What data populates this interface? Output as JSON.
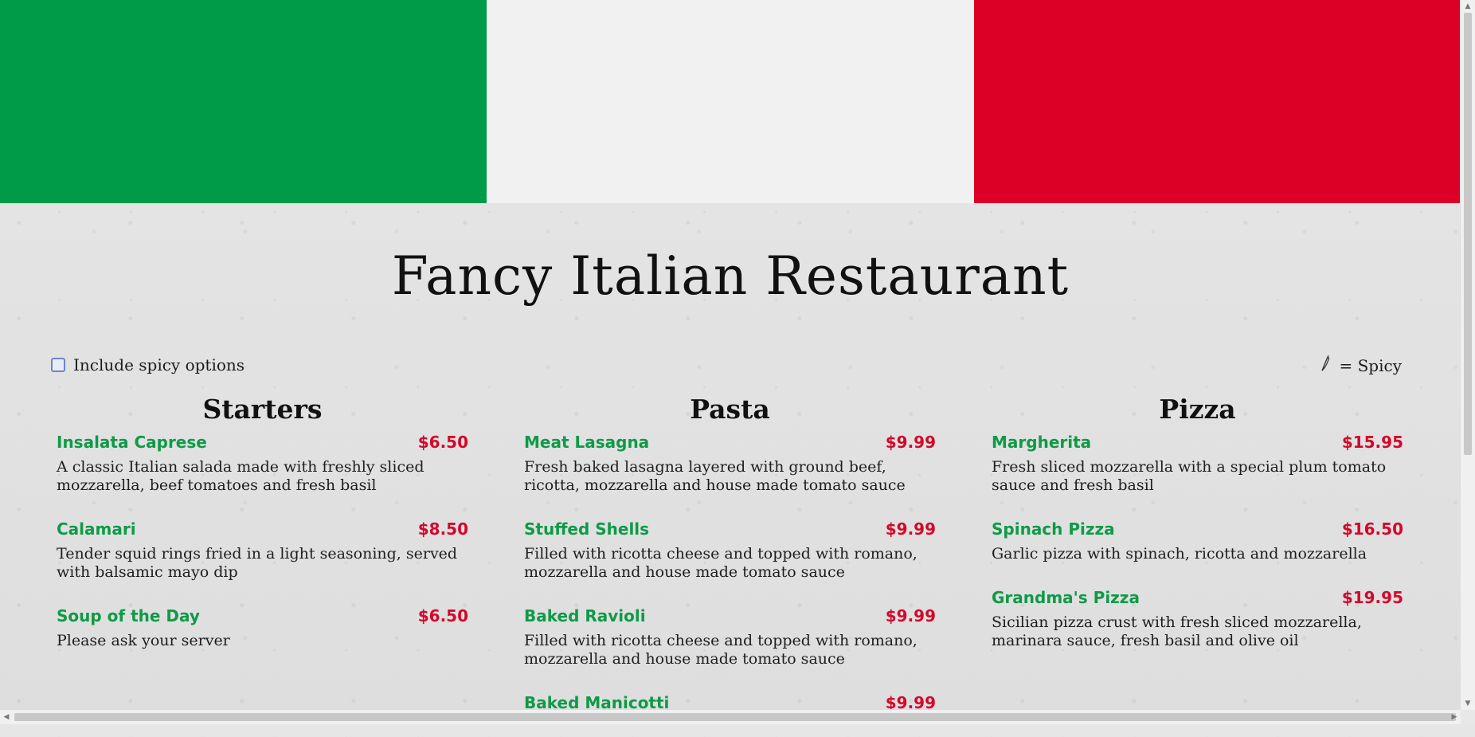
{
  "colors": {
    "green": "#009b48",
    "white": "#f1f1f1",
    "red": "#dc0026"
  },
  "page": {
    "title": "Fancy Italian Restaurant"
  },
  "spicy_toggle": {
    "label": "Include spicy options",
    "checked": false
  },
  "legend": {
    "icon": "chili-pepper-icon",
    "text": "= Spicy"
  },
  "menu": [
    {
      "heading": "Starters",
      "items": [
        {
          "name": "Insalata Caprese",
          "price": "$6.50",
          "desc": "A classic Italian salada made with freshly sliced mozzarella, beef tomatoes and fresh basil"
        },
        {
          "name": "Calamari",
          "price": "$8.50",
          "desc": "Tender squid rings fried in a light seasoning, served with balsamic mayo dip"
        },
        {
          "name": "Soup of the Day",
          "price": "$6.50",
          "desc": "Please ask your server"
        }
      ]
    },
    {
      "heading": "Pasta",
      "items": [
        {
          "name": "Meat Lasagna",
          "price": "$9.99",
          "desc": "Fresh baked lasagna layered with ground beef, ricotta, mozzarella and house made tomato sauce"
        },
        {
          "name": "Stuffed Shells",
          "price": "$9.99",
          "desc": "Filled with ricotta cheese and topped with romano, mozzarella and house made tomato sauce"
        },
        {
          "name": "Baked Ravioli",
          "price": "$9.99",
          "desc": "Filled with ricotta cheese and topped with romano, mozzarella and house made tomato sauce"
        },
        {
          "name": "Baked Manicotti",
          "price": "$9.99",
          "desc": ""
        }
      ]
    },
    {
      "heading": "Pizza",
      "items": [
        {
          "name": "Margherita",
          "price": "$15.95",
          "desc": "Fresh sliced mozzarella with a special plum tomato sauce and fresh basil"
        },
        {
          "name": "Spinach Pizza",
          "price": "$16.50",
          "desc": "Garlic pizza with spinach, ricotta and mozzarella"
        },
        {
          "name": "Grandma's Pizza",
          "price": "$19.95",
          "desc": "Sicilian pizza crust with fresh sliced mozzarella, marinara sauce, fresh basil and olive oil"
        }
      ]
    }
  ]
}
